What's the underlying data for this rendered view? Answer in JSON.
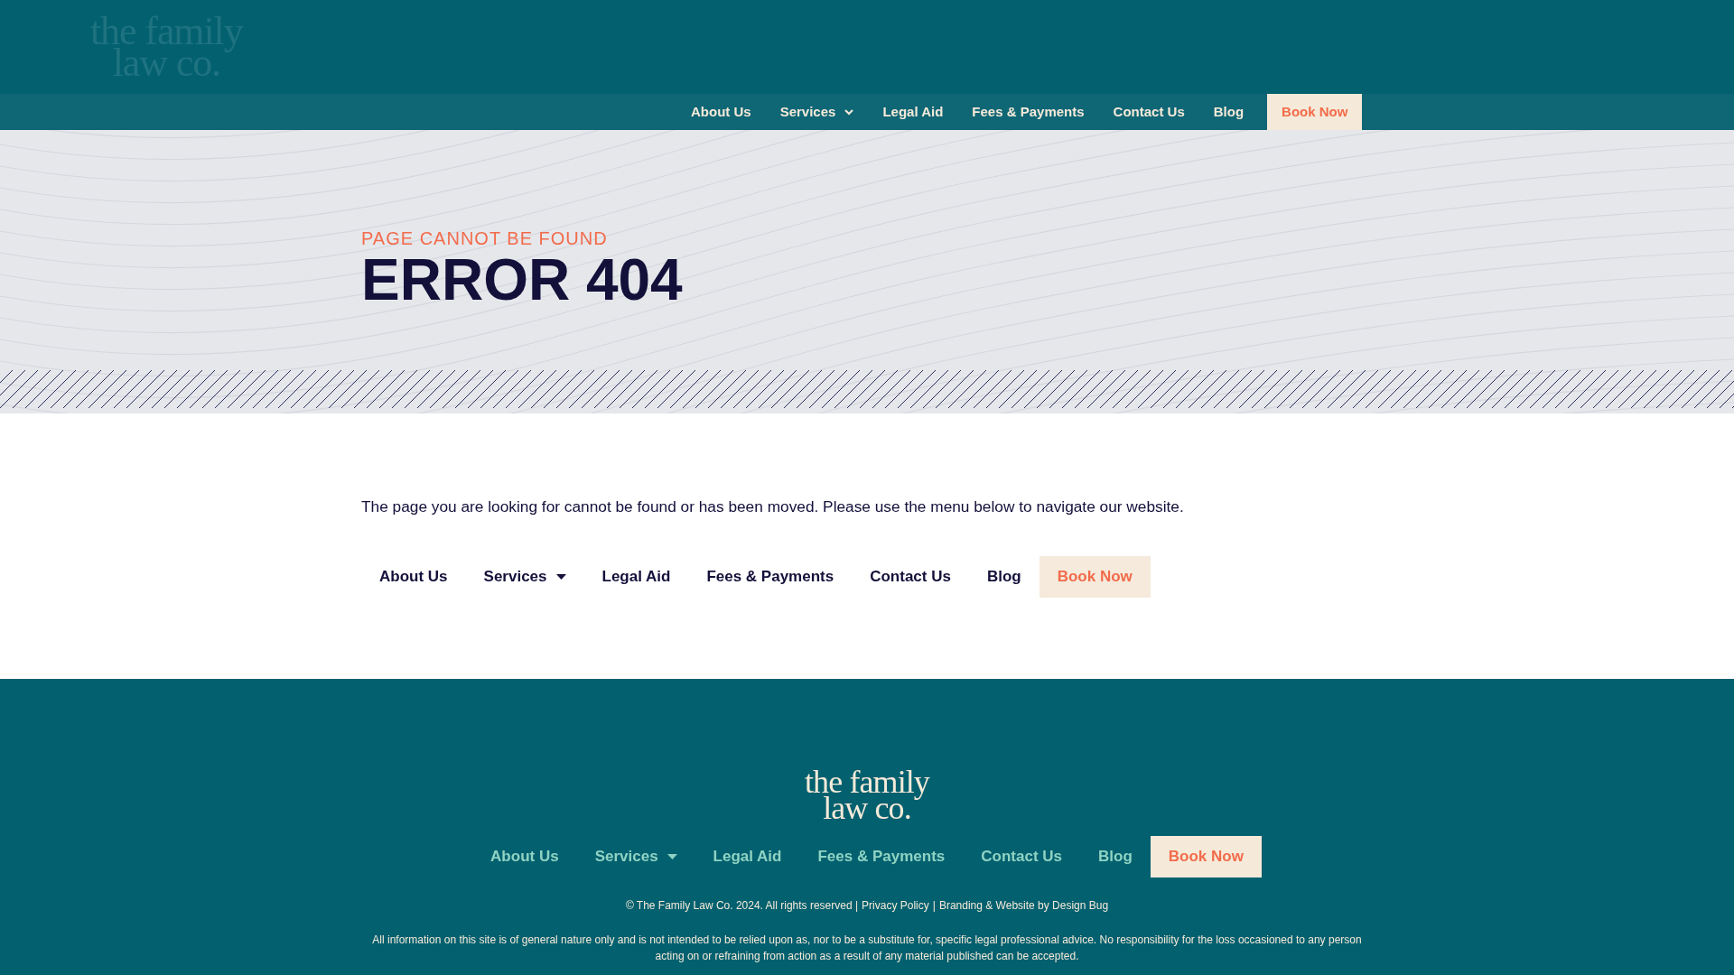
{
  "header": {
    "logo": {
      "line1": "the family",
      "line2": "law co."
    },
    "nav": [
      {
        "label": "About Us",
        "kind": "link"
      },
      {
        "label": "Services",
        "kind": "dropdown"
      },
      {
        "label": "Legal Aid",
        "kind": "link"
      },
      {
        "label": "Fees & Payments",
        "kind": "link"
      },
      {
        "label": "Contact Us",
        "kind": "link"
      },
      {
        "label": "Blog",
        "kind": "link"
      },
      {
        "label": "Book Now",
        "kind": "button"
      }
    ]
  },
  "hero": {
    "eyebrow": "PAGE CANNOT BE FOUND",
    "title": "ERROR 404"
  },
  "content": {
    "message": "The page you are looking for cannot be found or has been moved. Please use the menu below to navigate our website.",
    "nav": [
      {
        "label": "About Us",
        "kind": "link"
      },
      {
        "label": "Services",
        "kind": "dropdown"
      },
      {
        "label": "Legal Aid",
        "kind": "link"
      },
      {
        "label": "Fees & Payments",
        "kind": "link"
      },
      {
        "label": "Contact Us",
        "kind": "link"
      },
      {
        "label": "Blog",
        "kind": "link"
      },
      {
        "label": "Book Now",
        "kind": "button"
      }
    ]
  },
  "footer": {
    "logo": {
      "line1": "the family",
      "line2": "law co."
    },
    "nav": [
      {
        "label": "About Us",
        "kind": "link"
      },
      {
        "label": "Services",
        "kind": "dropdown"
      },
      {
        "label": "Legal Aid",
        "kind": "link"
      },
      {
        "label": "Fees & Payments",
        "kind": "link"
      },
      {
        "label": "Contact Us",
        "kind": "link"
      },
      {
        "label": "Blog",
        "kind": "link"
      },
      {
        "label": "Book Now",
        "kind": "button"
      }
    ],
    "copyright": {
      "notice": "© The Family Law Co. 2024. All rights reserved |",
      "privacy_link": "Privacy Policy",
      "separator": "|",
      "credit_link": "Branding & Website by Design Bug"
    },
    "disclaimer": "All information on this site is of general nature only and is not intended to be relied upon as, nor to be a substitute for, specific legal professional advice. No responsibility for the loss occasioned to any person acting on or refraining from action as a result of any material published can be accepted."
  }
}
